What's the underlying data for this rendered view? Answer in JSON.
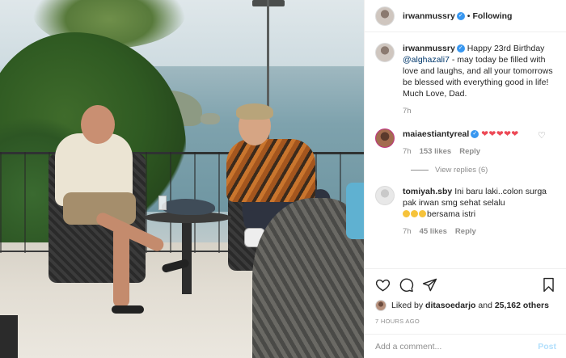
{
  "colors": {
    "verified": "#3897f0",
    "link": "#00376b",
    "muted": "#8e8e8e",
    "heart": "#ed4956",
    "post_disabled": "#b2dffc"
  },
  "header": {
    "username": "irwanmussry",
    "separator": "•",
    "follow_label": "Following"
  },
  "caption": {
    "username": "irwanmussry",
    "text_before": "Happy 23rd Birthday ",
    "mention": "@alghazali7",
    "text_after": " - may today be filled with love and laughs, and all your tomorrows be blessed with everything good in life!",
    "signoff": "Much Love, Dad.",
    "time": "7h"
  },
  "comments": [
    {
      "username": "maiaestiantyreal",
      "text": "❤❤❤❤❤",
      "time": "7h",
      "likes": "153 likes",
      "reply": "Reply",
      "view_replies": "View replies (6)"
    },
    {
      "username": "tomiyah.sby",
      "text": "Ini baru laki..colon surga pak irwan smg sehat selalu",
      "text2": "bersama istri",
      "time": "7h",
      "likes": "45 likes",
      "reply": "Reply"
    }
  ],
  "liked_by": {
    "prefix": "Liked by ",
    "user": "ditasoedarjo",
    "middle": " and ",
    "count": "25,162 others"
  },
  "timestamp": "7 HOURS AGO",
  "comment_box": {
    "placeholder": "Add a comment...",
    "post_label": "Post"
  }
}
